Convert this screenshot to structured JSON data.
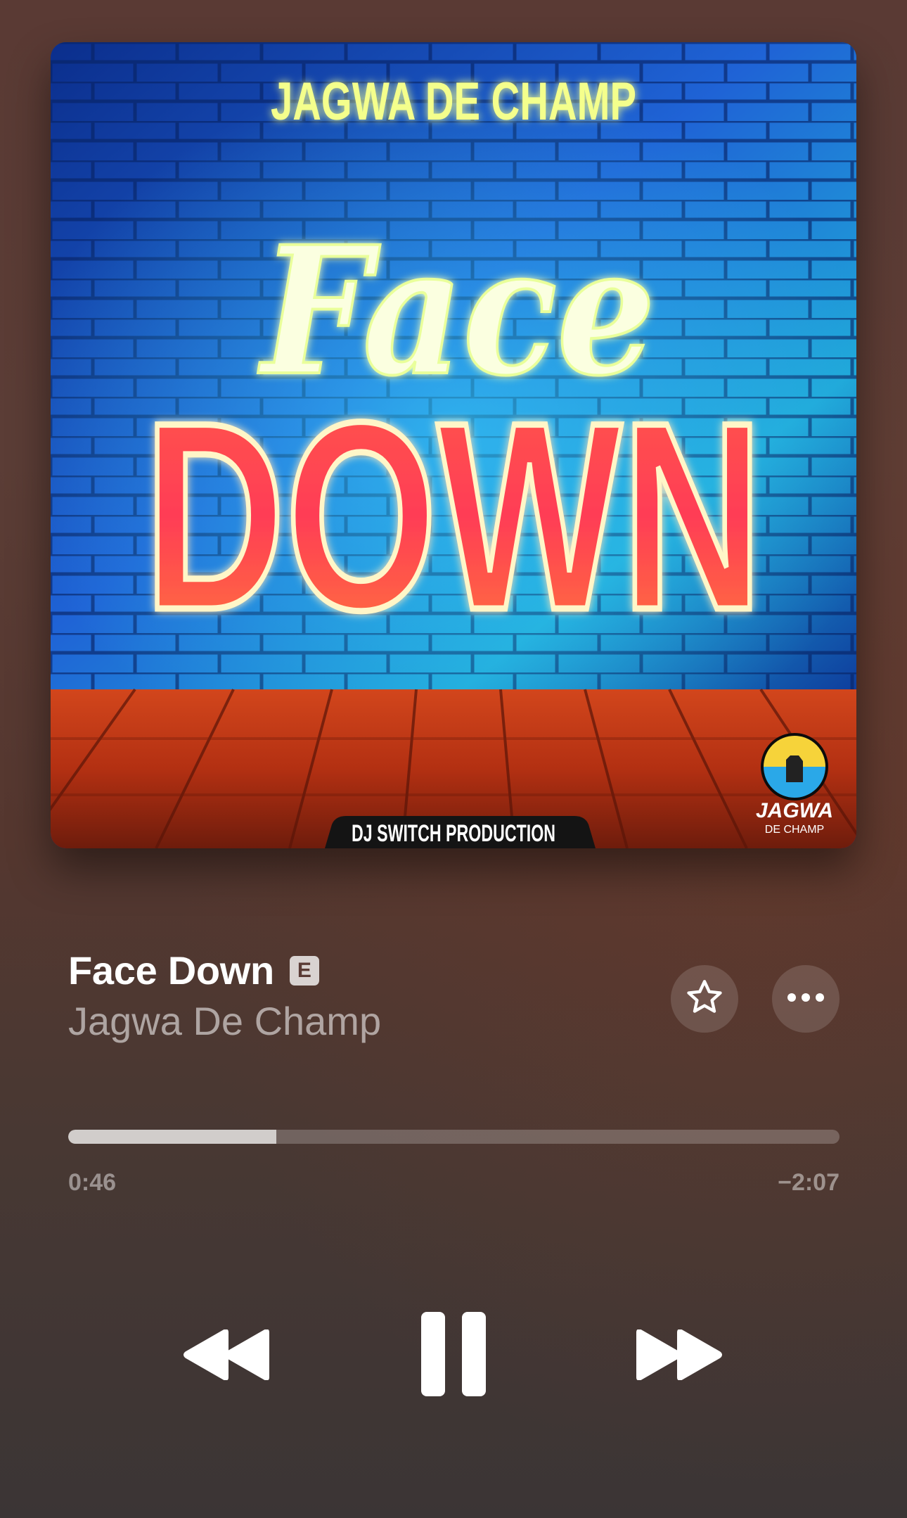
{
  "artwork": {
    "header_text": "JAGWA DE CHAMP",
    "title_script": "Face",
    "title_block": "DOWN",
    "footer_text": "DJ SWITCH PRODUCTION",
    "logo_text": "JAGWA",
    "logo_subtext": "DE CHAMP"
  },
  "track": {
    "title": "Face Down",
    "explicit_badge": "E",
    "artist": "Jagwa De Champ"
  },
  "playback": {
    "progress_fraction": 0.27,
    "elapsed": "0:46",
    "remaining": "−2:07"
  },
  "buttons": {
    "favorite_icon": "star-outline-icon",
    "more_icon": "ellipsis-icon",
    "previous_icon": "backward-icon",
    "play_pause_icon": "pause-icon",
    "next_icon": "forward-icon"
  },
  "colors": {
    "background_top": "#5a3a34",
    "background_bottom": "#3b3535",
    "text_primary": "#ffffff",
    "text_secondary": "rgba(255,255,255,0.55)"
  }
}
